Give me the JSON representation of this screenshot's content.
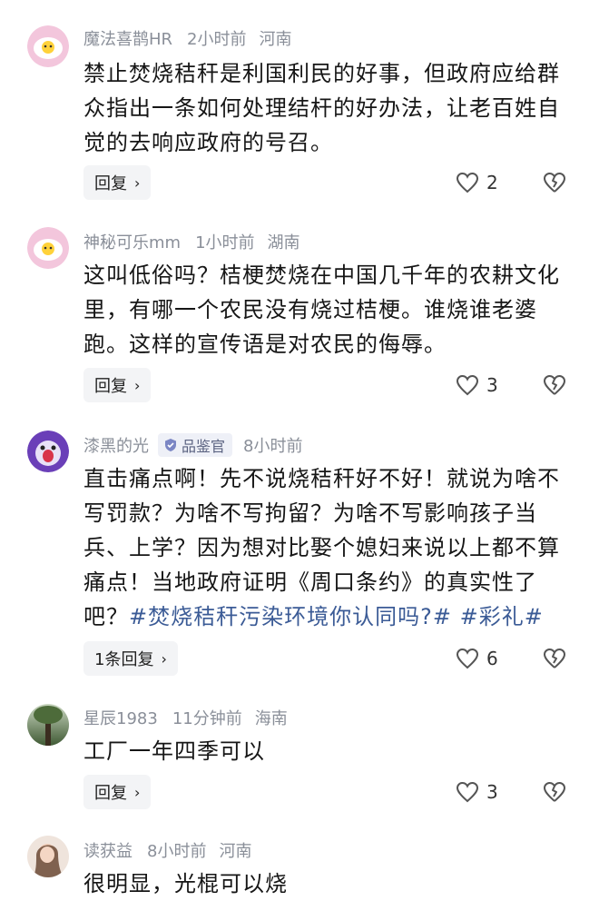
{
  "comments": [
    {
      "name": "魔法喜鹊HR",
      "time": "2小时前",
      "location": "河南",
      "text": "禁止焚烧秸秆是利国利民的好事，但政府应给群众指出一条如何处理结杆的好办法，让老百姓自觉的去响应政府的号召。",
      "reply_label": "回复",
      "likes": "2",
      "avatar": "egg-avatar"
    },
    {
      "name": "神秘可乐mm",
      "time": "1小时前",
      "location": "湖南",
      "text": "这叫低俗吗？桔梗焚烧在中国几千年的农耕文化里，有哪一个农民没有烧过桔梗。谁烧谁老婆跑。这样的宣传语是对农民的侮辱。",
      "reply_label": "回复",
      "likes": "3",
      "avatar": "egg-avatar"
    },
    {
      "name": "漆黑的光",
      "badge": "品鉴官",
      "time": "8小时前",
      "location": "",
      "text": "直击痛点啊！先不说烧秸秆好不好！就说为啥不写罚款？为啥不写拘留？为啥不写影响孩子当兵、上学？因为想对比娶个媳妇来说以上都不算痛点！当地政府证明《周口条约》的真实性了吧？",
      "hashtags": [
        "#焚烧秸秆污染环境你认同吗?#",
        "#彩礼#"
      ],
      "reply_label": "1条回复",
      "likes": "6",
      "avatar": "cartoon-avatar"
    },
    {
      "name": "星辰1983",
      "time": "11分钟前",
      "location": "海南",
      "text": "工厂一年四季可以",
      "reply_label": "回复",
      "likes": "3",
      "avatar": "forest-avatar"
    },
    {
      "name": "读获益",
      "time": "8小时前",
      "location": "河南",
      "text": "很明显，光棍可以烧",
      "avatar": "photo-avatar"
    }
  ],
  "colors": {
    "meta": "#8a8f99",
    "hashtag": "#3b5b96",
    "reply_bg": "#f3f4f6"
  }
}
